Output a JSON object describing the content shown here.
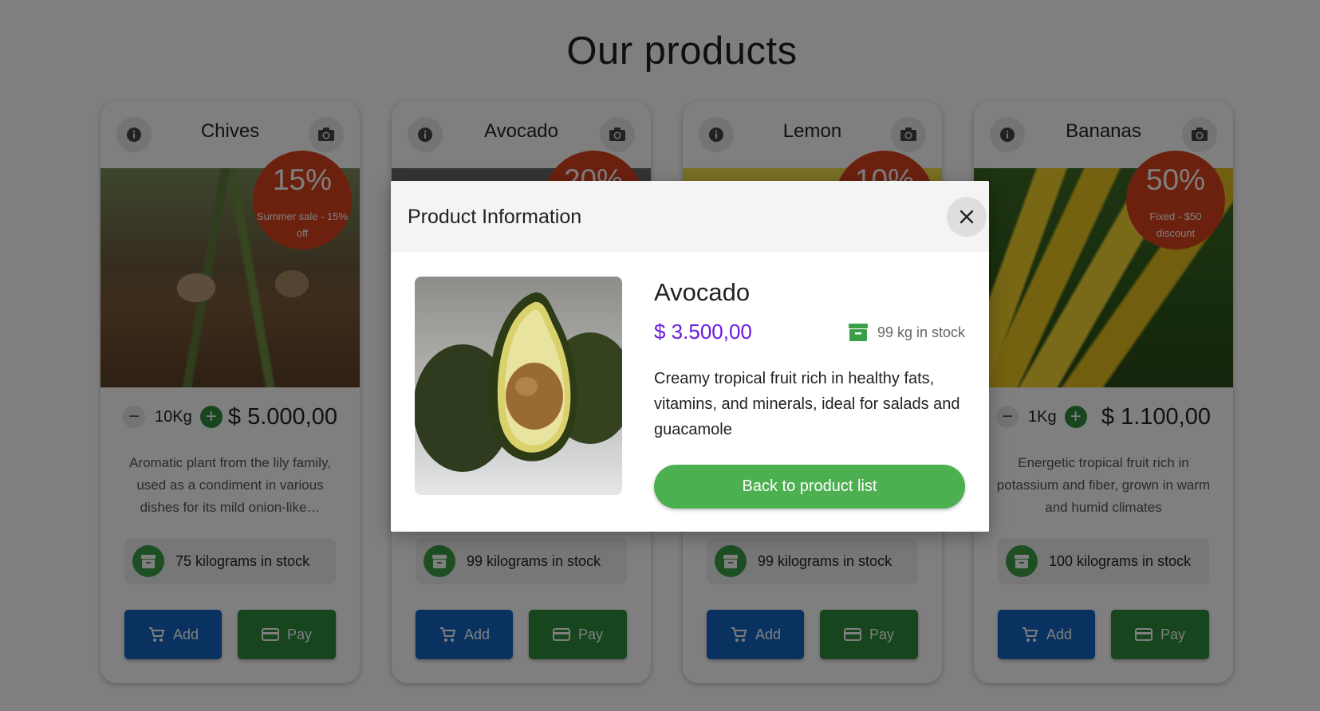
{
  "page": {
    "title": "Our products"
  },
  "products": [
    {
      "name": "Chives",
      "discount_percent": "15%",
      "discount_label": "Summer sale - 15% off",
      "quantity": "10Kg",
      "price": "$ 5.000,00",
      "description": "Aromatic plant from the lily family, used as a condiment in various dishes for its mild onion-like…",
      "stock": "75 kilograms in stock",
      "add_label": "Add",
      "pay_label": "Pay"
    },
    {
      "name": "Avocado",
      "discount_percent": "20%",
      "stock": "99 kilograms in stock",
      "add_label": "Add",
      "pay_label": "Pay"
    },
    {
      "name": "Lemon",
      "discount_percent": "10%",
      "stock": "99 kilograms in stock",
      "add_label": "Add",
      "pay_label": "Pay"
    },
    {
      "name": "Bananas",
      "discount_percent": "50%",
      "discount_label": "Fixed - $50 discount",
      "quantity": "1Kg",
      "price": "$ 1.100,00",
      "description": "Energetic tropical fruit rich in potassium and fiber, grown in warm and humid climates",
      "stock": "100 kilograms in stock",
      "add_label": "Add",
      "pay_label": "Pay"
    }
  ],
  "modal": {
    "title": "Product Information",
    "product_name": "Avocado",
    "price": "$ 3.500,00",
    "stock": "99 kg in stock",
    "description": "Creamy tropical fruit rich in healthy fats, vitamins, and minerals, ideal for salads and guacamole",
    "back_label": "Back to product list"
  },
  "colors": {
    "discount_badge": "#d9431e",
    "add_button": "#1565c0",
    "pay_button": "#2e8b3c",
    "modal_price": "#6a1be0",
    "back_button": "#4caf50",
    "overlay": "rgba(0,0,0,0.5)"
  },
  "icons": {
    "info": "info-icon",
    "camera": "camera-icon",
    "cart": "cart-icon",
    "card": "credit-card-icon",
    "stock": "archive-box-icon",
    "close": "close-icon"
  }
}
